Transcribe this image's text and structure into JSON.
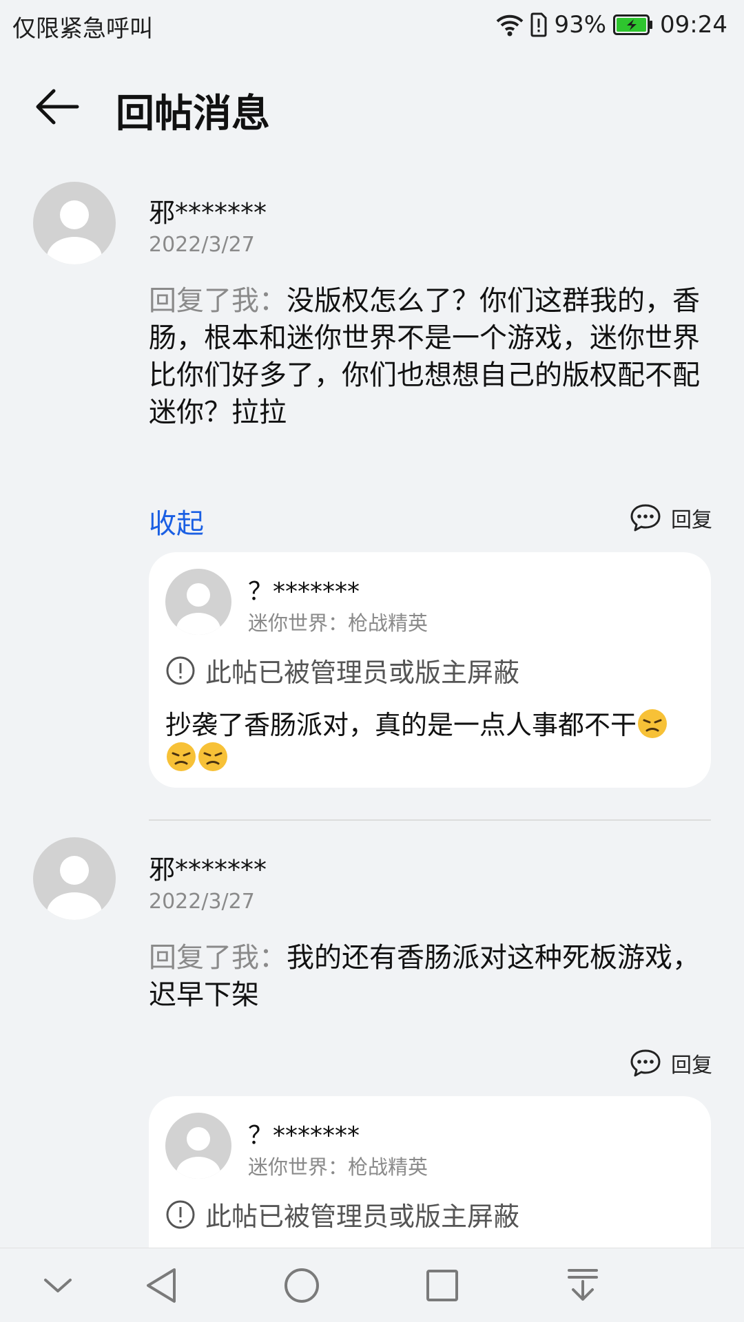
{
  "status_bar": {
    "emergency_text": "仅限紧急呼叫",
    "battery_percent": "93%",
    "time": "09:24",
    "icons": [
      "wifi-icon",
      "sim-alert-icon",
      "battery-charging-icon"
    ]
  },
  "header": {
    "title": "回帖消息",
    "back_icon": "arrow-left-icon"
  },
  "messages": [
    {
      "user": "邪*******",
      "date": "2022/3/27",
      "reply_prefix": "回复了我：",
      "reply_text": "没版权怎么了？你们这群我的，香肠，根本和迷你世界不是一个游戏，迷你世界比你们好多了，你们也想想自己的版权配不配迷你？拉拉",
      "collapse_label": "收起",
      "reply_label": "回复",
      "original_post": {
        "user": "？*******",
        "source": "迷你世界：枪战精英",
        "blocked_notice": "此帖已被管理员或版主屏蔽",
        "content": "抄袭了香肠派对，真的是一点人事都不干",
        "emoji_icon": "unamused-face-emoji"
      }
    },
    {
      "user": "邪*******",
      "date": "2022/3/27",
      "reply_prefix": "回复了我：",
      "reply_text": "我的还有香肠派对这种死板游戏，迟早下架",
      "reply_label": "回复",
      "original_post": {
        "user": "？*******",
        "source": "迷你世界：枪战精英",
        "blocked_notice": "此帖已被管理员或版主屏蔽"
      }
    }
  ],
  "nav_bar": {
    "icons": [
      "chevron-down-icon",
      "back-triangle-icon",
      "home-circle-icon",
      "recents-square-icon",
      "notification-pulldown-icon"
    ]
  },
  "colors": {
    "background": "#f1f3f5",
    "link_blue": "#1a5fe3",
    "secondary_text": "#8a8a8a",
    "card_background": "#ffffff",
    "avatar_gray": "#d2d2d2"
  }
}
